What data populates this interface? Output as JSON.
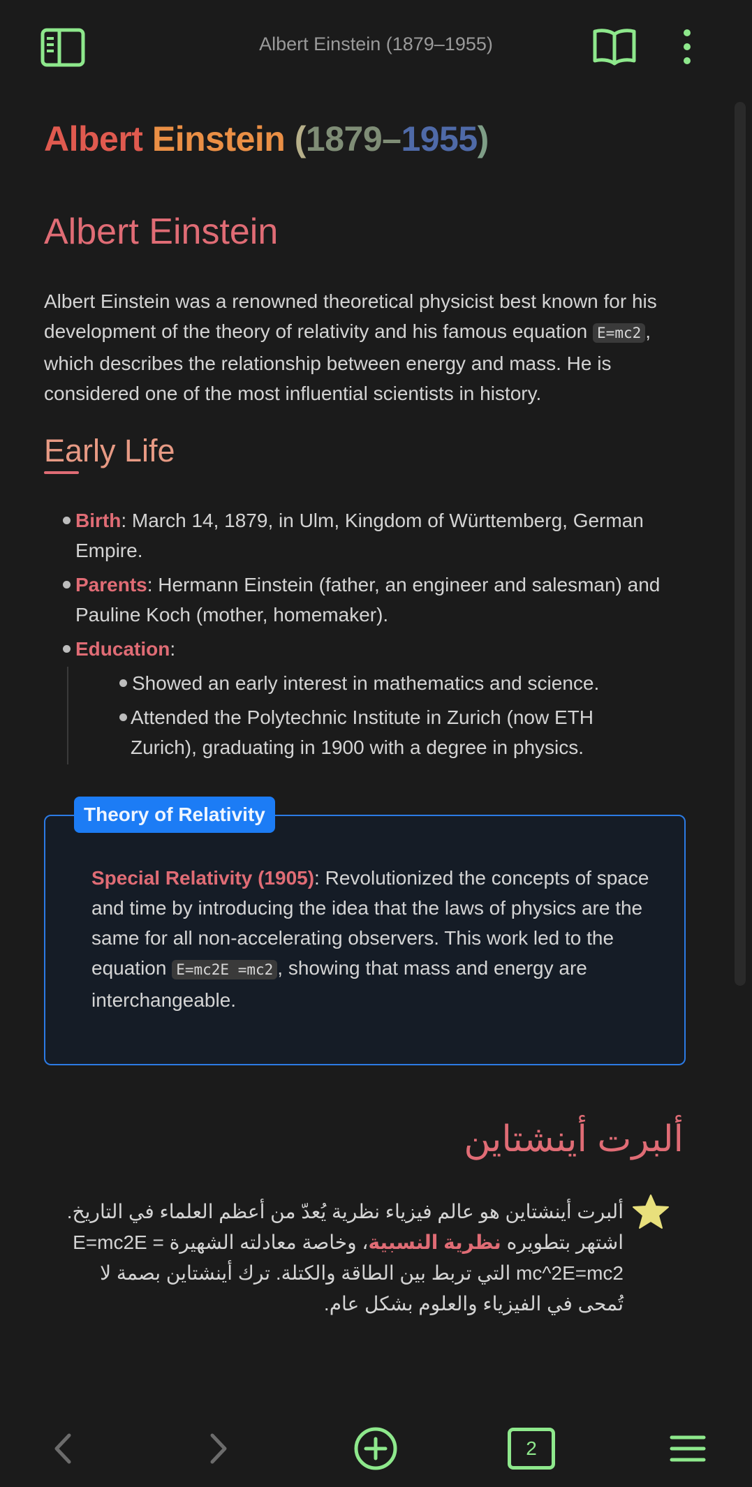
{
  "topbar": {
    "title": "Albert Einstein (1879–1955)",
    "left_icon": "sidebar-toggle-icon",
    "right_icons": [
      "book-open-icon",
      "more-vertical-icon"
    ]
  },
  "doc": {
    "title_parts": [
      {
        "text": "Albert ",
        "color": "#e05a4f"
      },
      {
        "text": "Einstein ",
        "color": "#ea8f45"
      },
      {
        "text": "(",
        "color": "#b7b08a"
      },
      {
        "text": "1879–",
        "color": "#7f8d76"
      },
      {
        "text": "1955",
        "color": "#4f6aa8"
      },
      {
        "text": ")",
        "color": "#7f9e87"
      }
    ],
    "h1": "Albert Einstein",
    "intro": {
      "before_code": "Albert Einstein was a renowned theoretical physicist best known for his development of the theory of relativity and his famous equation ",
      "code": "E=mc2",
      "after_code": ", which describes the relationship between energy and mass. He is considered one of the most influential scientists in history."
    },
    "early_life": {
      "heading": "Early Life",
      "items": [
        {
          "label": "Birth",
          "text": ": March 14, 1879, in Ulm, Kingdom of Württemberg, German Empire."
        },
        {
          "label": "Parents",
          "text": ": Hermann Einstein (father, an engineer and salesman) and Pauline Koch (mother, homemaker)."
        },
        {
          "label": "Education",
          "text": ":"
        }
      ],
      "education_sub": [
        "Showed an early interest in mathematics and science.",
        "Attended the Polytechnic Institute in Zurich (now ETH Zurich), graduating in 1900 with a degree in physics."
      ]
    },
    "callout": {
      "title": "Theory of Relativity",
      "label": "Special Relativity (1905)",
      "text_before_code": ": Revolutionized the concepts of space and time by introducing the idea that the laws of physics are the same for all non-accelerating observers. This work led to the equation ",
      "code": "E=mc2E =mc2",
      "text_after_code": ", showing that mass and energy are interchangeable."
    },
    "arabic": {
      "heading": "ألبرت أينشتاين",
      "before_highlight": "ألبرت أينشتاين هو عالم فيزياء نظرية يُعدّ من أعظم العلماء في التاريخ. اشتهر بتطويره ",
      "highlight": "نظرية النسبية",
      "after_highlight": "، وخاصة معادلته الشهيرة E=mc2E = mc^2E=mc2 التي تربط بين الطاقة والكتلة. ترك أينشتاين بصمة لا تُمحى في الفيزياء والعلوم بشكل عام.",
      "icon": "star-icon"
    }
  },
  "bottombar": {
    "tab_count": "2",
    "icons": [
      "back-arrow-icon",
      "forward-arrow-icon",
      "add-circle-icon",
      "tabs-icon",
      "menu-icon"
    ]
  },
  "colors": {
    "accent_green": "#8ee88c",
    "heading_red": "#e06c75",
    "callout_blue": "#2c7be5",
    "background": "#1b1b1b"
  }
}
